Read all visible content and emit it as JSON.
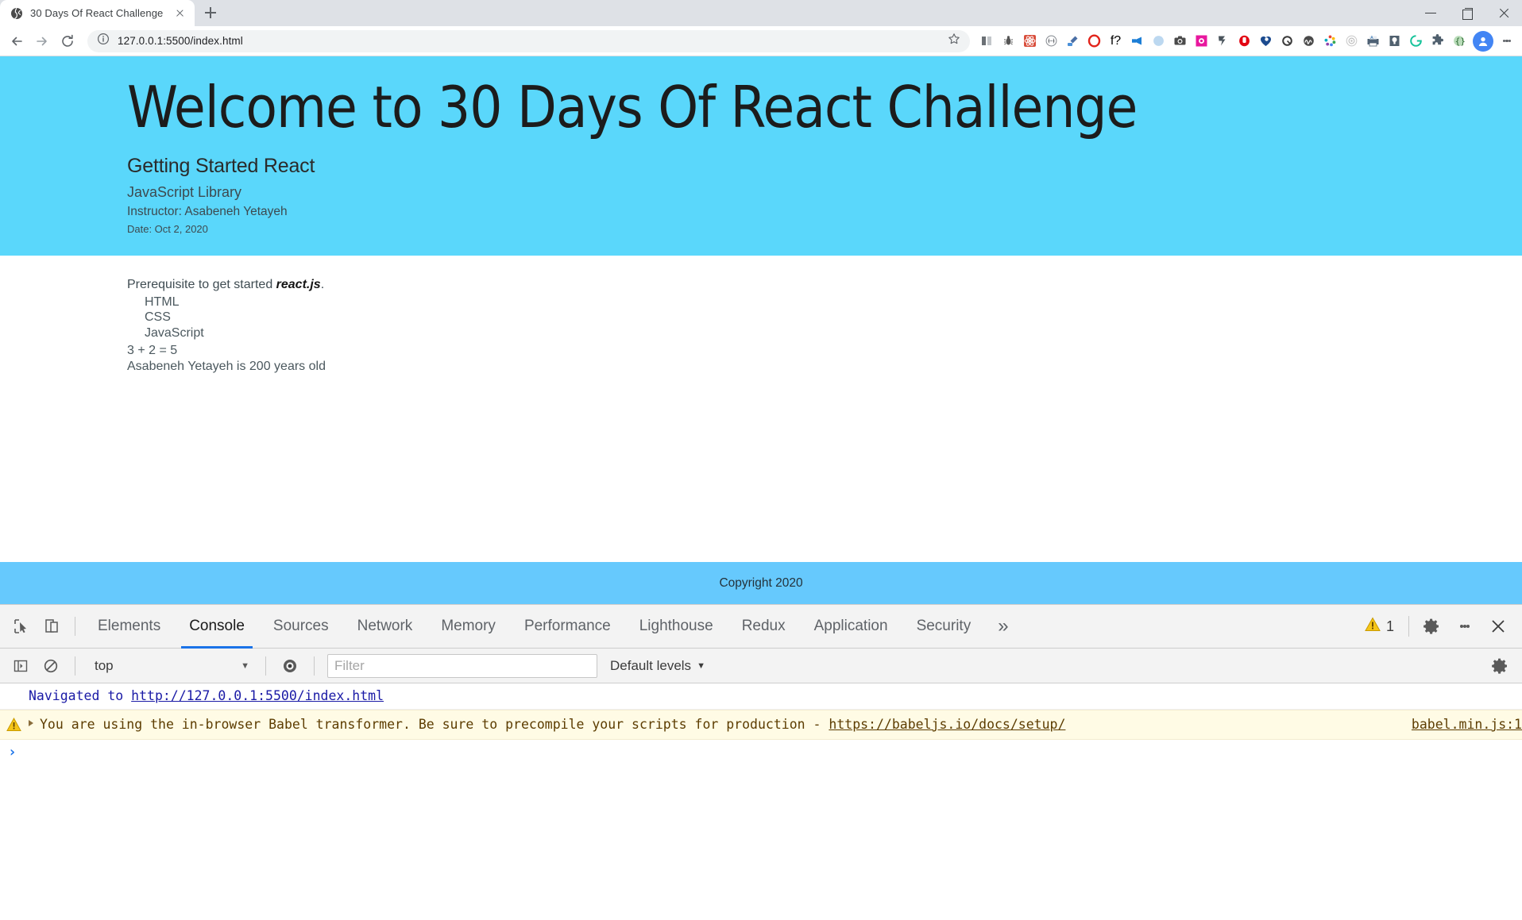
{
  "browser": {
    "tab": {
      "title": "30 Days Of React Challenge",
      "favicon": "globe-icon"
    },
    "newtab_label": "+",
    "address": {
      "protocol_hidden": true,
      "url": "127.0.0.1:5500/index.html",
      "host": "127.0.0.1:5500",
      "path": "/index.html"
    },
    "window_controls": [
      "minimize",
      "maximize",
      "close"
    ],
    "extensions": [
      "columns-icon",
      "bug-icon",
      "react-devtools-icon",
      "parentheses-icon",
      "eyedropper-icon",
      "opera-o-icon",
      "fonts-f-icon",
      "megaphone-icon",
      "moon-blue-icon",
      "camera-icon",
      "gear-pink-icon",
      "tag-icon",
      "shield-red-icon",
      "heart-blue-icon",
      "clock-dark-icon",
      "wave-icon",
      "color-wheel-icon",
      "spiral-icon",
      "printer-icon",
      "bulb-icon",
      "grammarly-g-icon",
      "puzzle-icon",
      "braces-icon"
    ],
    "profile_avatar": "user-avatar"
  },
  "page": {
    "header": {
      "title": "Welcome to 30 Days Of React Challenge",
      "subtitle": "Getting Started React",
      "library": "JavaScript Library",
      "instructor": "Instructor: Asabeneh Yetayeh",
      "date": "Date: Oct 2, 2020",
      "bg_color": "#5ad7fb"
    },
    "main": {
      "prereq_prefix": "Prerequisite to get started ",
      "prereq_bold": "react.js",
      "prereq_suffix": ".",
      "tech_list": [
        "HTML",
        "CSS",
        "JavaScript"
      ],
      "calculation": "3 + 2 = 5",
      "person_statement": "Asabeneh Yetayeh is 200 years old"
    },
    "footer": {
      "text": "Copyright 2020",
      "bg_color": "#66c9fd"
    }
  },
  "devtools": {
    "left_icons": [
      "inspect-element-icon",
      "device-toolbar-icon"
    ],
    "tabs": [
      {
        "label": "Elements",
        "active": false
      },
      {
        "label": "Console",
        "active": true
      },
      {
        "label": "Sources",
        "active": false
      },
      {
        "label": "Network",
        "active": false
      },
      {
        "label": "Memory",
        "active": false
      },
      {
        "label": "Performance",
        "active": false
      },
      {
        "label": "Lighthouse",
        "active": false
      },
      {
        "label": "Redux",
        "active": false
      },
      {
        "label": "Application",
        "active": false
      },
      {
        "label": "Security",
        "active": false
      }
    ],
    "more_tabs_label": "»",
    "warning_count": "1",
    "right_icons": [
      "settings-gear-icon",
      "devtools-menu-icon",
      "close-devtools-icon"
    ],
    "console_toolbar": {
      "execute_icon": "console-sidebar-icon",
      "clear_icon": "clear-console-icon",
      "context": "top",
      "context_caret": "▼",
      "live_expression_icon": "eye-icon",
      "filter_placeholder": "Filter",
      "filter_value": "",
      "levels_label": "Default levels",
      "levels_caret": "▼",
      "settings_icon": "console-settings-icon"
    },
    "messages": [
      {
        "type": "navigation",
        "prefix": "Navigated to ",
        "link": "http://127.0.0.1:5500/index.html"
      },
      {
        "type": "warning",
        "icon": "warning-triangle-icon",
        "expand_arrow": "▸",
        "text": "You are using the in-browser Babel transformer. Be sure to precompile your scripts for production - ",
        "link": "https://babeljs.io/docs/setup/",
        "link_visible_part_1": "https://babeljs.io/do",
        "link_visible_part_2": "cs/setup/",
        "source": "babel.min.js:1"
      }
    ],
    "prompt": "›"
  }
}
